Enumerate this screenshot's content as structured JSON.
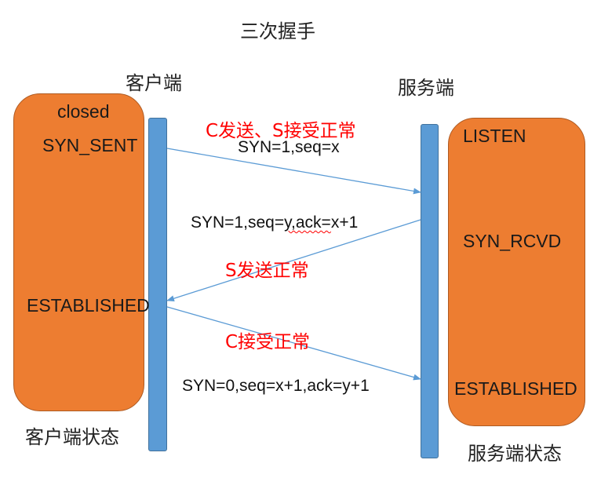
{
  "title": "三次握手",
  "client": {
    "label": "客户端",
    "footer": "客户端状态",
    "states": {
      "closed": "closed",
      "syn_sent": "SYN_SENT",
      "established": "ESTABLISHED"
    }
  },
  "server": {
    "label": "服务端",
    "footer": "服务端状态",
    "states": {
      "listen": "LISTEN",
      "syn_rcvd": "SYN_RCVD",
      "established": "ESTABLISHED"
    }
  },
  "messages": {
    "first": {
      "note": "C发送、S接受正常",
      "label": "SYN=1,seq=x"
    },
    "second": {
      "label_prefix": "SYN=1,seq=",
      "label_marked": "y,ack=",
      "label_suffix": "x+1",
      "note": "S发送正常"
    },
    "third": {
      "note": "C接受正常",
      "label": "SYN=0,seq=x+1,ack=y+1"
    }
  },
  "colors": {
    "state_box": "#ed7d31",
    "lifeline": "#5b9bd5",
    "arrow": "#5b9bd5",
    "note": "#ff0000"
  }
}
